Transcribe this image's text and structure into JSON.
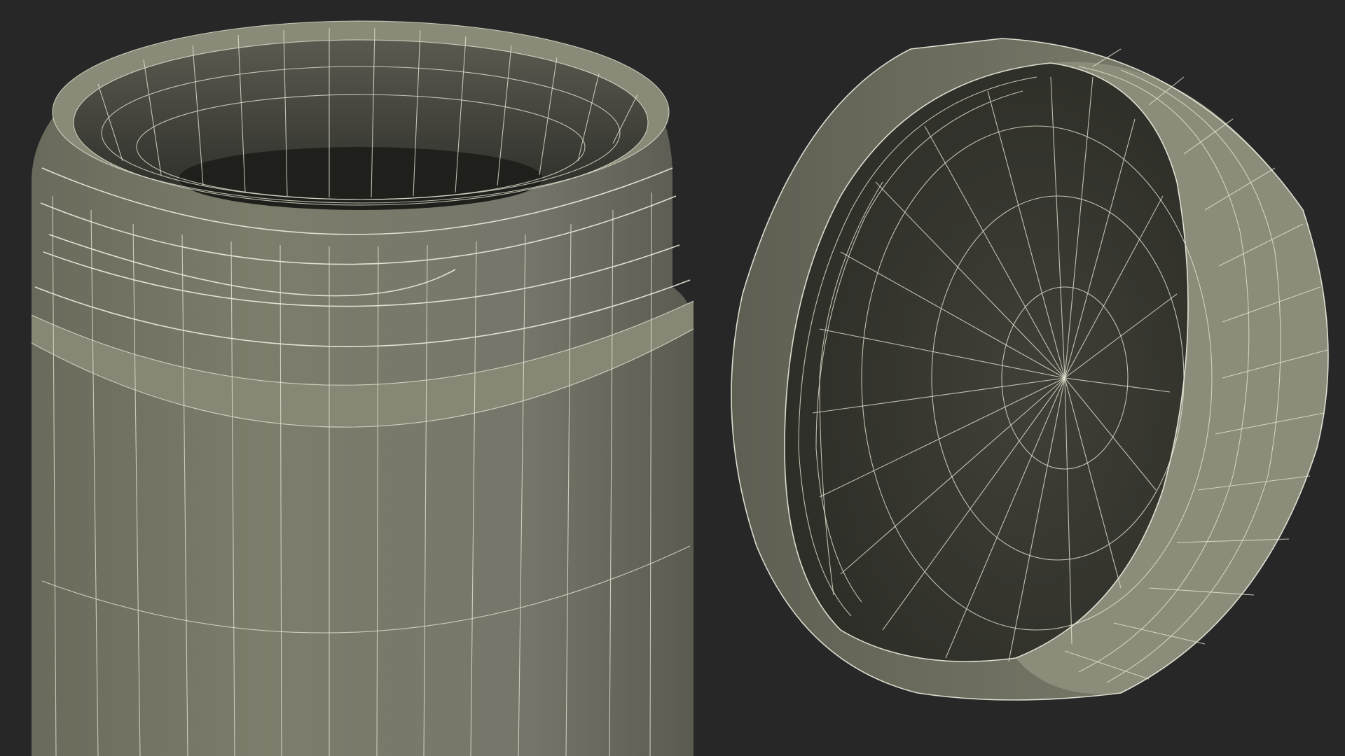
{
  "scene": {
    "background": "#272727",
    "wire_color": "#e4e4d2",
    "surface_color": "#787868",
    "interior_color": "#3c3c34",
    "objects": [
      {
        "name": "jar",
        "display": "wireframe-over-shaded",
        "features": [
          "open-mouth",
          "screw-threads",
          "shoulder",
          "body-band"
        ]
      },
      {
        "name": "lid",
        "display": "wireframe-over-shaded",
        "features": [
          "outer-rim",
          "inner-wall",
          "thread",
          "radial-base"
        ]
      }
    ]
  }
}
